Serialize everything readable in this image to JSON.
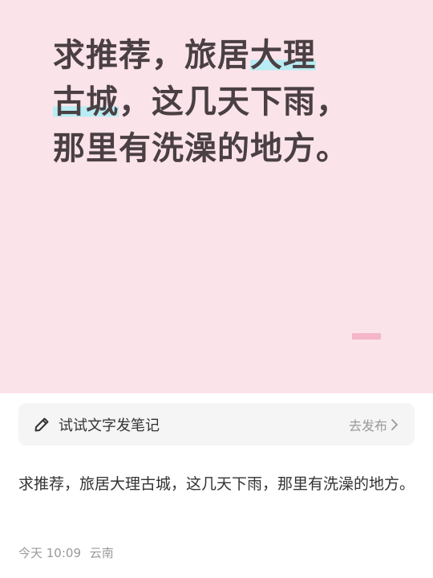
{
  "cover": {
    "line1_a": "求推荐，旅居",
    "line1_b": "大理",
    "line2_a": "古城",
    "line2_b": "，这几天下雨，",
    "line3": "那里有洗澡的地方。",
    "highlight_color": "#b9ecf3",
    "background_color": "#fbe3ea"
  },
  "prompt": {
    "icon": "pencil-icon",
    "label": "试试文字发笔记",
    "action": "去发布",
    "chevron": "chevron-right-icon"
  },
  "post": {
    "content": "求推荐，旅居大理古城，这几天下雨，那里有洗澡的地方。",
    "date": "今天 10:09",
    "location": "云南"
  }
}
